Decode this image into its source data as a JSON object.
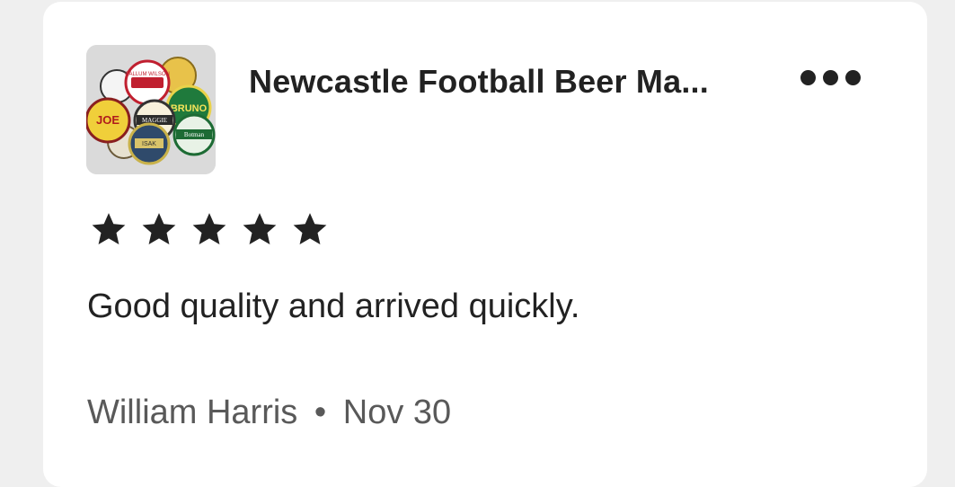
{
  "listing": {
    "title": "Newcastle Football Beer Ma...",
    "thumbnail_alt": "beer mats collage",
    "thumbnail_labels": [
      "CALLUM WILSON",
      "BRUNO",
      "JOE",
      "MAGGIE",
      "Botman",
      "ISAK"
    ],
    "more_icon": "more-horizontal-icon"
  },
  "review": {
    "rating": 5,
    "rating_max": 5,
    "star_icon": "star-icon",
    "text": "Good quality and arrived quickly.",
    "author": "William Harris",
    "separator": "•",
    "date": "Nov 30"
  },
  "colors": {
    "page_bg": "#efefef",
    "card_bg": "#ffffff",
    "text_primary": "#222222",
    "text_secondary": "#595959"
  }
}
